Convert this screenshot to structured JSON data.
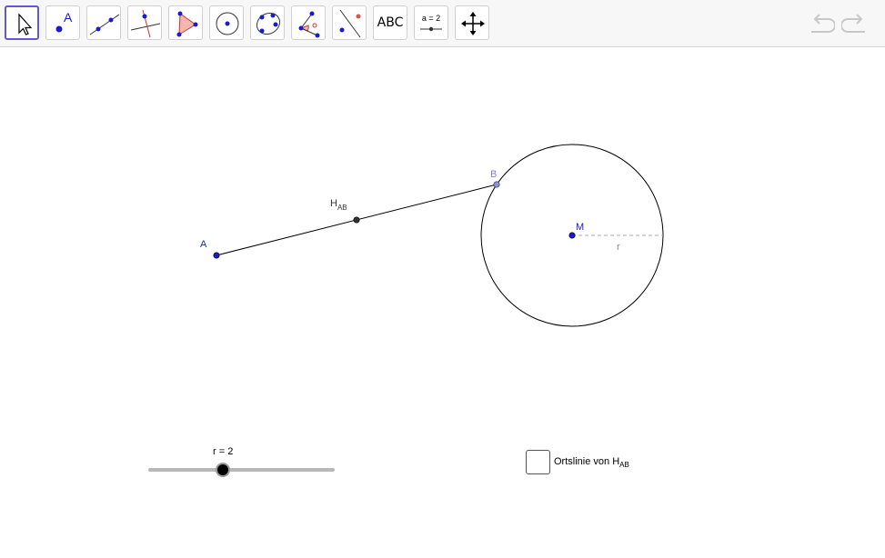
{
  "toolbar": {
    "tools": [
      {
        "name": "move-tool",
        "label": ""
      },
      {
        "name": "point-tool",
        "label": "A"
      },
      {
        "name": "line-tool",
        "label": ""
      },
      {
        "name": "perpendicular-line-tool",
        "label": ""
      },
      {
        "name": "polygon-tool",
        "label": ""
      },
      {
        "name": "circle-center-point-tool",
        "label": ""
      },
      {
        "name": "conic-five-points-tool",
        "label": ""
      },
      {
        "name": "angle-tool",
        "label": ""
      },
      {
        "name": "reflect-about-line-tool",
        "label": ""
      },
      {
        "name": "text-tool",
        "label": "ABC"
      },
      {
        "name": "slider-tool",
        "label": "a = 2"
      },
      {
        "name": "move-graphics-view-tool",
        "label": ""
      }
    ],
    "selected_tool": "move-tool",
    "undo_icon": "undo-icon",
    "redo_icon": "redo-icon"
  },
  "construction": {
    "point_a_label": "A",
    "point_b_label": "B",
    "point_m_label": "M",
    "midpoint_label_main": "H",
    "midpoint_label_sub": "AB",
    "radius_label": "r"
  },
  "slider": {
    "label": "r = 2",
    "fraction": 0.4
  },
  "checkbox": {
    "label_main": "Ortslinie von H",
    "label_sub": "AB",
    "checked": false
  },
  "colors": {
    "point_free": "#0000cc",
    "point_b": "#8080e0",
    "selected_border": "#6557d2",
    "midpoint": "#333333"
  }
}
